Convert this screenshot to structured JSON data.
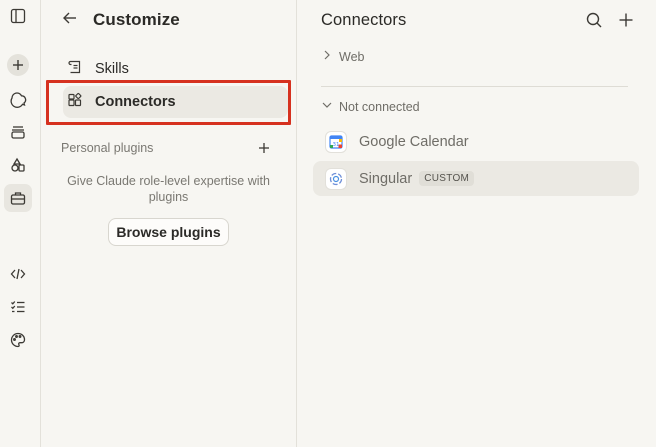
{
  "rail": {
    "icons": [
      "sidebar-toggle-icon",
      "new-chat-icon",
      "chats-icon",
      "projects-icon",
      "artifacts-icon",
      "customize-icon",
      "code-icon",
      "tasks-icon",
      "palette-icon"
    ]
  },
  "customize": {
    "title": "Customize",
    "nav": [
      {
        "label": "Skills",
        "icon": "skills-icon"
      },
      {
        "label": "Connectors",
        "icon": "connectors-icon",
        "selected": true
      }
    ],
    "personal_plugins_label": "Personal plugins",
    "empty_text": "Give Claude role-level expertise with plugins",
    "browse_button": "Browse plugins"
  },
  "connectors": {
    "title": "Connectors",
    "groups": [
      {
        "label": "Web",
        "expanded": false
      },
      {
        "label": "Not connected",
        "expanded": true
      }
    ],
    "items": [
      {
        "name": "Google Calendar",
        "badge": ""
      },
      {
        "name": "Singular",
        "badge": "CUSTOM"
      }
    ]
  },
  "colors": {
    "background": "#f7f6f2",
    "highlight": "#d6311f",
    "selected_bg": "#ebe9e3"
  }
}
